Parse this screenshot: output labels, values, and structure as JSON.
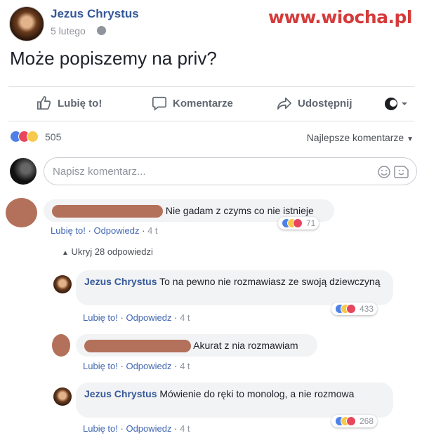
{
  "post": {
    "author": "Jezus Chrystus",
    "date": "5 lutego",
    "text": "Może popiszemy na priv?",
    "watermark": "www.wiocha.pl"
  },
  "actions": {
    "like": "Lubię to!",
    "comment": "Komentarze",
    "share": "Udostępnij"
  },
  "reactions": {
    "count": "505",
    "sort_label": "Najlepsze komentarze"
  },
  "comment_input": {
    "placeholder": "Napisz komentarz..."
  },
  "comments": [
    {
      "text": "Nie gadam z czyms co nie istnieje",
      "like": "Lubię to!",
      "reply": "Odpowiedz",
      "time": "4 t",
      "reactions": "71"
    }
  ],
  "hide_replies": "Ukryj 28 odpowiedzi",
  "replies": [
    {
      "author": "Jezus Chrystus",
      "text": "To na pewno nie rozmawiasz ze swoją dziewczyną",
      "like": "Lubię to!",
      "reply": "Odpowiedz",
      "time": "4 t",
      "reactions": "433"
    },
    {
      "text": "Akurat z nia rozmawiam",
      "like": "Lubię to!",
      "reply": "Odpowiedz",
      "time": "4 t"
    },
    {
      "author": "Jezus Chrystus",
      "text": "Mówienie do ręki to monolog, a nie rozmowa",
      "like": "Lubię to!",
      "reply": "Odpowiedz",
      "time": "4 t",
      "reactions": "268"
    }
  ],
  "colors": {
    "link": "#365899",
    "like_blue": "#4d81e7",
    "love_red": "#e8465d",
    "haha_yellow": "#f7c94c",
    "redaction": "#b3705a"
  }
}
